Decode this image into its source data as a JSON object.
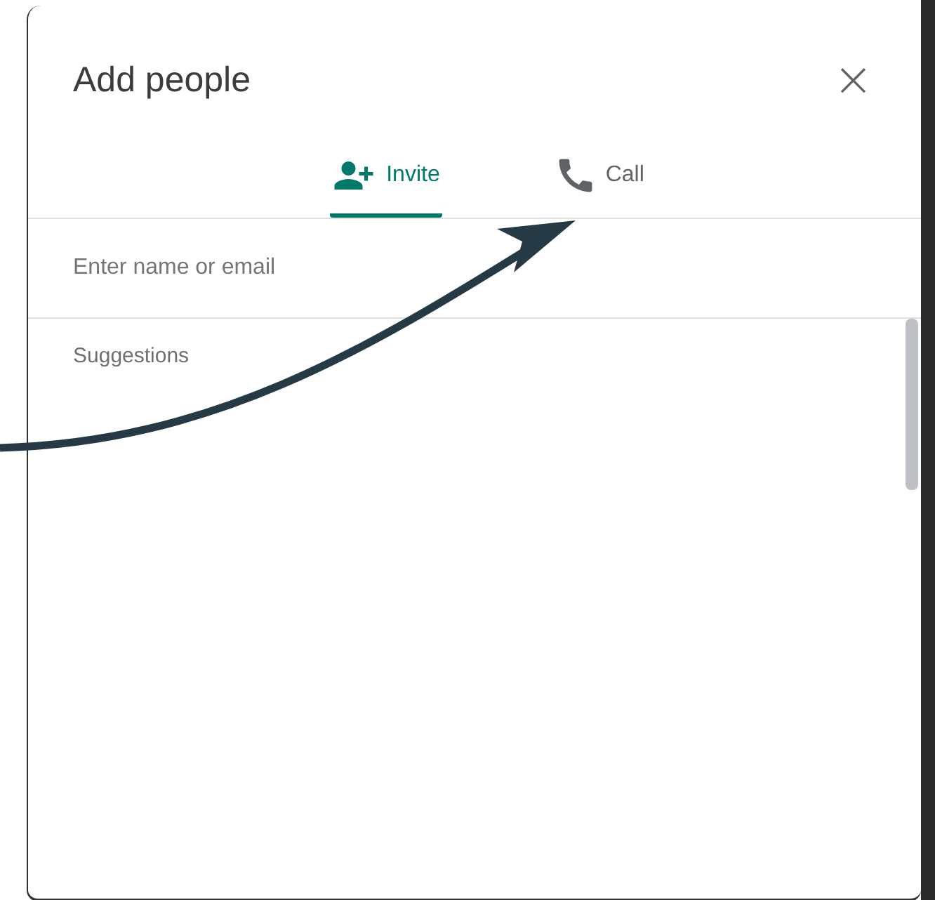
{
  "dialog": {
    "title": "Add people",
    "close": "×"
  },
  "tabs": [
    {
      "label": "Invite",
      "kind": "invite",
      "selected": true
    },
    {
      "label": "Call",
      "kind": "call",
      "selected": false
    }
  ],
  "search": {
    "placeholder": "Enter name or email"
  },
  "suggestions": {
    "heading": "Suggestions"
  }
}
